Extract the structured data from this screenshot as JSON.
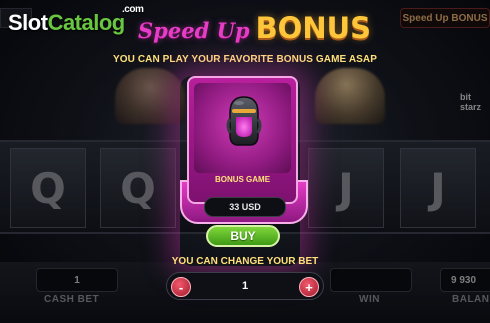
{
  "logo": {
    "part1": "Slot",
    "part2": "Catalog",
    "suffix": ".com"
  },
  "title": {
    "speed_up": "Speed Up",
    "bonus": "BONUS"
  },
  "subtitle": "YOU CAN PLAY YOUR FAVORITE BONUS GAME ASAP",
  "card": {
    "label": "BONUS GAME",
    "price": "33 USD",
    "icon": "boxing-helmet-icon"
  },
  "buy_label": "BUY",
  "bet": {
    "label": "YOU CAN CHANGE YOUR BET",
    "value": "1",
    "minus": "-",
    "plus": "+"
  },
  "background": {
    "reels": [
      "Q",
      "Q",
      "J",
      "J"
    ],
    "bottom_bar": {
      "cash_bet_value": "1",
      "cash_bet_label": "CASH BET",
      "win_label": "WIN",
      "balance_value": "9 930",
      "balance_label": "BALAN"
    },
    "top_right": "Speed Up BONUS",
    "brand": "bit starz"
  },
  "colors": {
    "accent_pink": "#e73cc5",
    "gold": "#ffc63a",
    "buy_green": "#5fb826",
    "label_yellow": "#ffe07a"
  }
}
